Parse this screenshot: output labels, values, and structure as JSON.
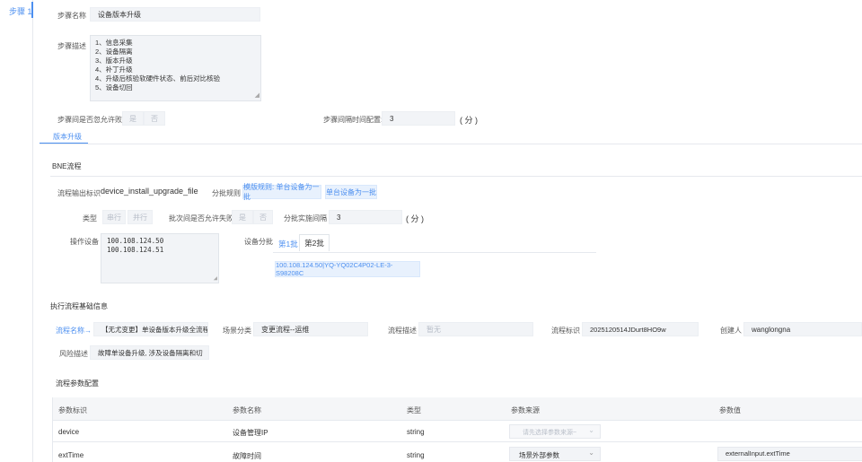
{
  "sidebar": {
    "step_tab": "步骤 1"
  },
  "step": {
    "name_label": "步骤名称",
    "name_value": "设备版本升级",
    "desc_label": "步骤描述",
    "desc_lines": [
      "1、信息采集",
      "2、设备隔离",
      "3、版本升级",
      "4、补丁升级",
      "4、升级后核验软硬件状态、前后对比核验",
      "5、设备切回"
    ],
    "ignore_fail_label": "步骤间是否忽允许败:",
    "yes": "是",
    "no": "否",
    "interval_label": "步骤间隔时间配置:",
    "interval_value": "3",
    "interval_unit": "( 分 )"
  },
  "tabs": {
    "active": "版本升级"
  },
  "bne": {
    "title": "BNE流程",
    "output_label": "流程输出标识",
    "output_value": "device_install_upgrade_file",
    "batch_rule_label": "分批规则",
    "batch_rule_btn1": "模版规则: 单台设备为一批",
    "batch_rule_btn2": "单台设备为一批",
    "type_label": "类型",
    "type_serial": "串行",
    "type_parallel": "并行",
    "batch_fail_label": "批次间是否允许失败",
    "yes": "是",
    "no": "否",
    "batch_interval_label": "分批实施间隔",
    "batch_interval_value": "3",
    "batch_interval_unit": "( 分 )",
    "devices_label": "操作设备",
    "devices": [
      "100.108.124.50",
      "100.108.124.51"
    ],
    "device_batch_label": "设备分批",
    "batch_tabs": [
      "第1批",
      "第2批"
    ],
    "batch_device_tag": "100.108.124.50|YQ-YQ02C4P02-LE-3-S98208C"
  },
  "exec": {
    "title": "执行流程基础信息",
    "flow_name_label": "流程名称→",
    "flow_name_value": "【无尤变更】单设备版本升级全流程",
    "scene_label": "场景分类",
    "scene_value": "变更流程--运维",
    "flow_desc_label": "流程描述",
    "flow_desc_placeholder": "暂无",
    "flow_id_label": "流程标识",
    "flow_id_value": "2025120514JDurt8HO9w",
    "creator_label": "创建人",
    "creator_value": "wanglongna",
    "risk_label": "风险描述",
    "risk_value": "故障单设备升级, 涉及设备隔离和切"
  },
  "params": {
    "title": "流程参数配置",
    "headers": [
      "参数标识",
      "参数名称",
      "类型",
      "参数来源",
      "参数值"
    ],
    "rows": [
      {
        "id": "device",
        "name": "设备管理IP",
        "type": "string",
        "source": "请先选择参数来源~",
        "source_placeholder": true,
        "value": ""
      },
      {
        "id": "extTime",
        "name": "故障时间",
        "type": "string",
        "source": "场景外部参数",
        "source_placeholder": false,
        "value": "externalInput.extTime"
      }
    ]
  }
}
